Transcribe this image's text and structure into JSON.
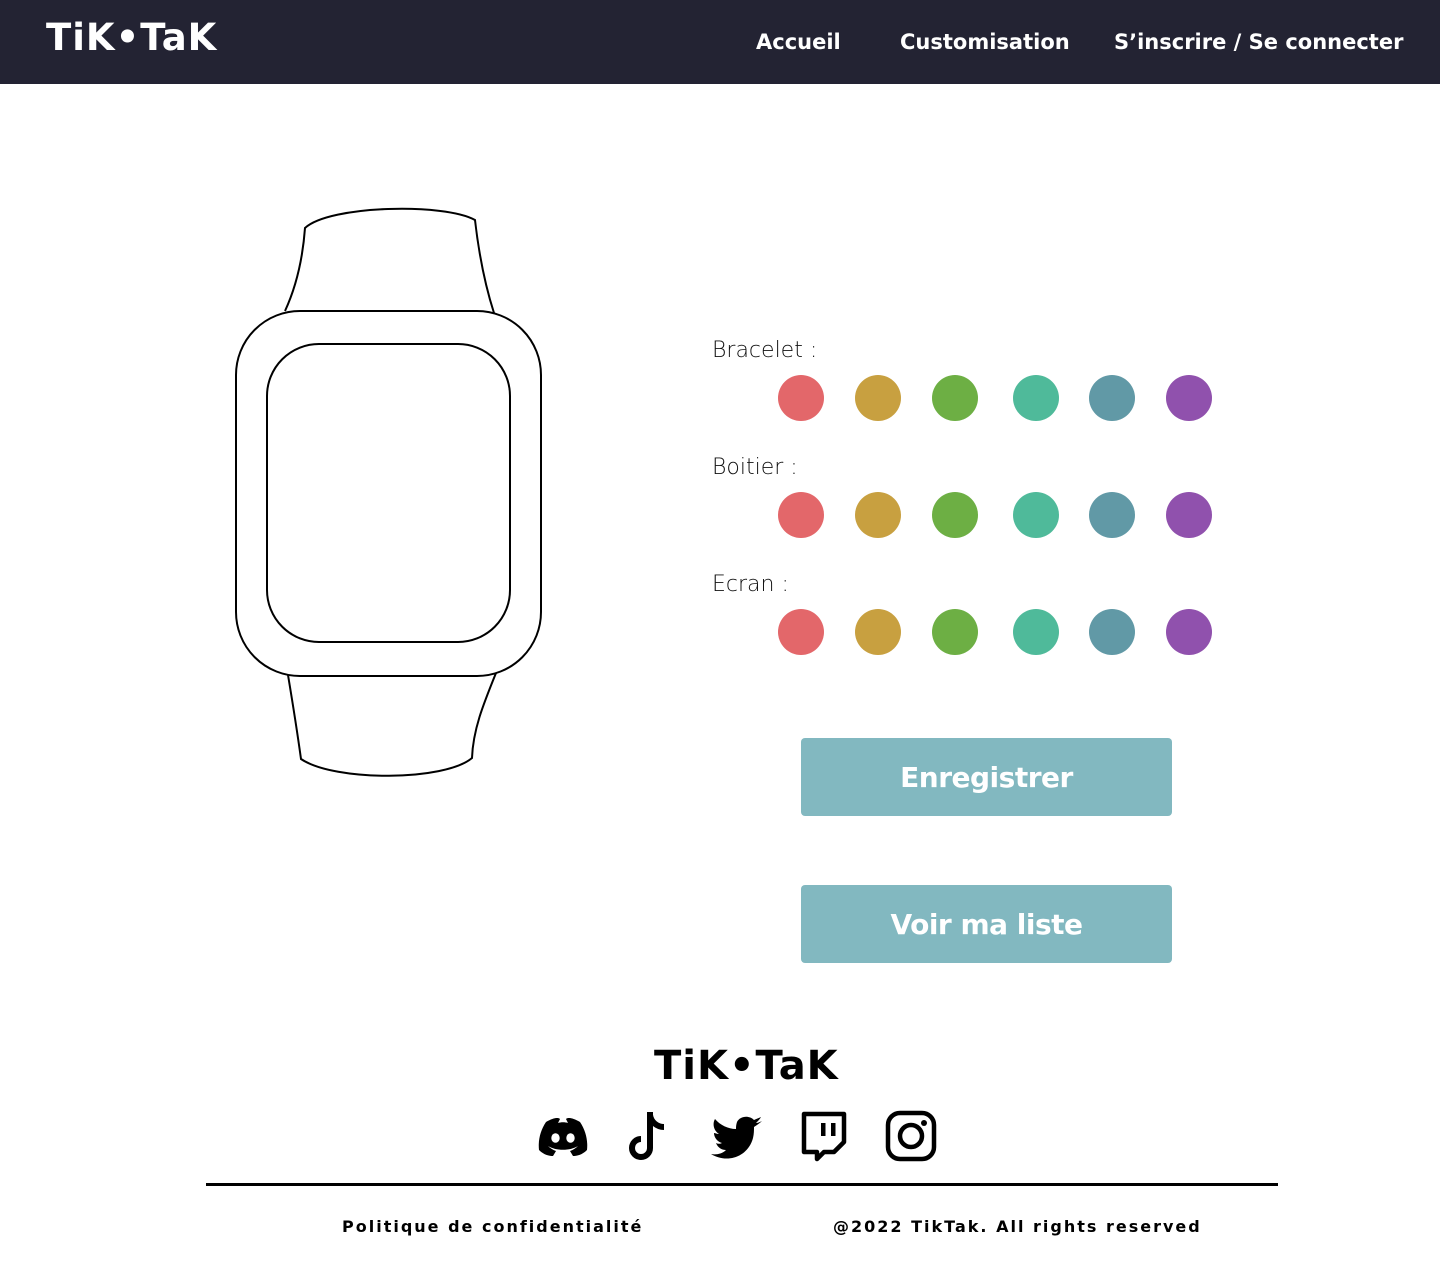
{
  "nav": {
    "logo": "TiK•TaK",
    "links": [
      "Accueil",
      "Customisation",
      "S’inscrire / Se connecter"
    ]
  },
  "customizer": {
    "options": [
      {
        "label": "Bracelet :"
      },
      {
        "label": "Boitier :"
      },
      {
        "label": "Ecran :"
      }
    ],
    "palette": [
      "#e3676a",
      "#c8a040",
      "#6daf44",
      "#4fba9a",
      "#6199a6",
      "#9051ad"
    ],
    "buttons": {
      "save": "Enregistrer",
      "list": "Voir ma liste"
    }
  },
  "footer": {
    "logo": "TiK•TaK",
    "social_icons": [
      "discord-icon",
      "tiktok-icon",
      "twitter-icon",
      "twitch-icon",
      "instagram-icon"
    ],
    "privacy": "Politique de confidentialité",
    "copyright": "@2022 TikTak. All rights reserved"
  }
}
